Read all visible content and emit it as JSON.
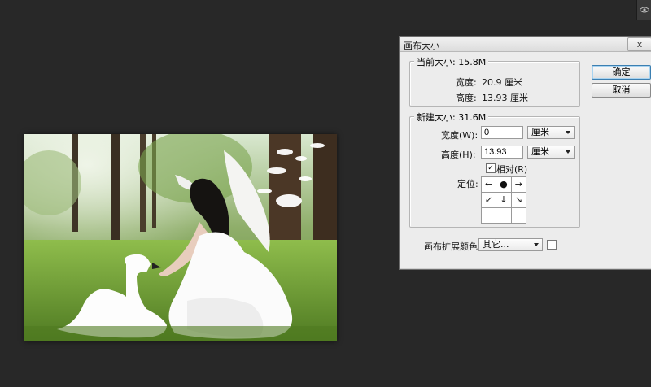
{
  "dialog": {
    "title": "画布大小",
    "close_label": "x",
    "ok_label": "确定",
    "cancel_label": "取消"
  },
  "current_size": {
    "legend": "当前大小: 15.8M",
    "width_label": "宽度:",
    "width_value": "20.9 厘米",
    "height_label": "高度:",
    "height_value": "13.93 厘米"
  },
  "new_size": {
    "legend": "新建大小: 31.6M",
    "width_label": "宽度(W):",
    "width_value": "0",
    "width_unit": "厘米",
    "height_label": "高度(H):",
    "height_value": "13.93",
    "height_unit": "厘米",
    "relative_label": "相对(R)",
    "relative_checked": true,
    "anchor_label": "定位:",
    "anchor_grid": [
      "←",
      "●",
      "→",
      "↙",
      "↓",
      "↘",
      "",
      "",
      ""
    ]
  },
  "canvas_extension": {
    "label": "画布扩展颜色:",
    "value": "其它...",
    "swatch_color": "#ffffff"
  },
  "colors": {
    "workspace_bg": "#282828",
    "dialog_bg": "#ececec"
  },
  "icons": [
    "eye-icon",
    "dropdown-arrow-icon",
    "checkmark-icon"
  ]
}
